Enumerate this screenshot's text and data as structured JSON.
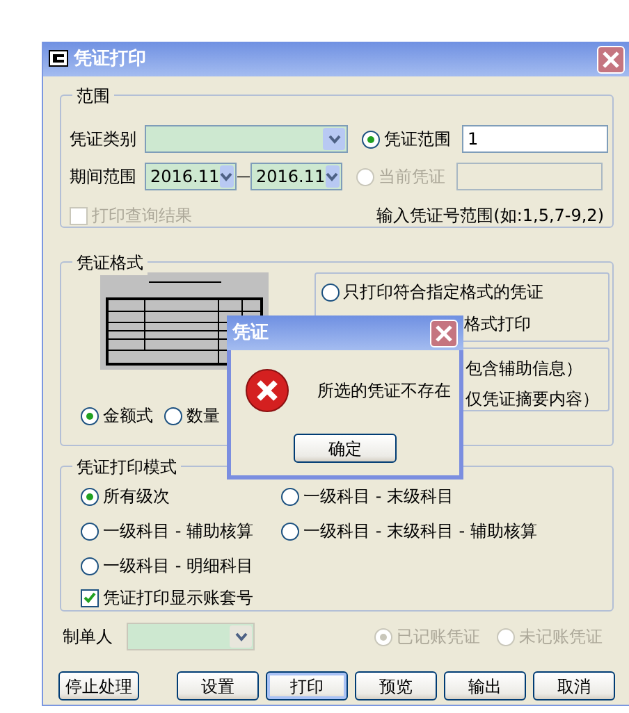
{
  "window": {
    "title": "凭证打印"
  },
  "range": {
    "title": "范围",
    "voucher_type": {
      "label": "凭证类别"
    },
    "period": {
      "label": "期间范围",
      "from": "2016.11",
      "to": "2016.11",
      "separator": "—"
    },
    "modes": [
      {
        "label": "凭证范围",
        "selected": true,
        "disabled": false,
        "value": "1"
      },
      {
        "label": "当前凭证",
        "selected": false,
        "disabled": true
      }
    ],
    "print_query": {
      "label": "打印查询结果",
      "checked": false,
      "disabled": true
    },
    "hint": "输入凭证号范围(如:1,5,7-9,2)"
  },
  "format": {
    "title": "凭证格式",
    "filter_options": [
      {
        "label": "只打印符合指定格式的凭证",
        "selected": false
      }
    ],
    "covered_texts": [
      "格式打印",
      "包含辅助信息）",
      "仅凭证摘要内容）"
    ],
    "styles": [
      {
        "label": "金额式",
        "selected": true
      },
      {
        "label": "数量",
        "selected": false
      }
    ]
  },
  "print_mode": {
    "title": "凭证打印模式",
    "options": [
      {
        "label": "所有级次",
        "selected": true
      },
      {
        "label": "一级科目 - 末级科目",
        "selected": false
      },
      {
        "label": "一级科目 - 辅助核算",
        "selected": false
      },
      {
        "label": "一级科目 - 末级科目 - 辅助核算",
        "selected": false
      },
      {
        "label": "一级科目 - 明细科目",
        "selected": false
      }
    ],
    "show_account_set": {
      "label": "凭证打印显示账套号",
      "checked": true
    }
  },
  "maker": {
    "label": "制单人",
    "disabled": true
  },
  "posting": [
    {
      "label": "已记账凭证",
      "selected": true,
      "disabled": true
    },
    {
      "label": "未记账凭证",
      "selected": false,
      "disabled": true
    }
  ],
  "buttons": [
    {
      "label": "停止处理",
      "focused": false
    },
    {
      "label": "设置",
      "focused": false
    },
    {
      "label": "打印",
      "focused": true
    },
    {
      "label": "预览",
      "focused": false
    },
    {
      "label": "输出",
      "focused": false
    },
    {
      "label": "取消",
      "focused": false
    }
  ],
  "dialog": {
    "title": "凭证",
    "message": "所选的凭证不存在",
    "button": "确定"
  }
}
